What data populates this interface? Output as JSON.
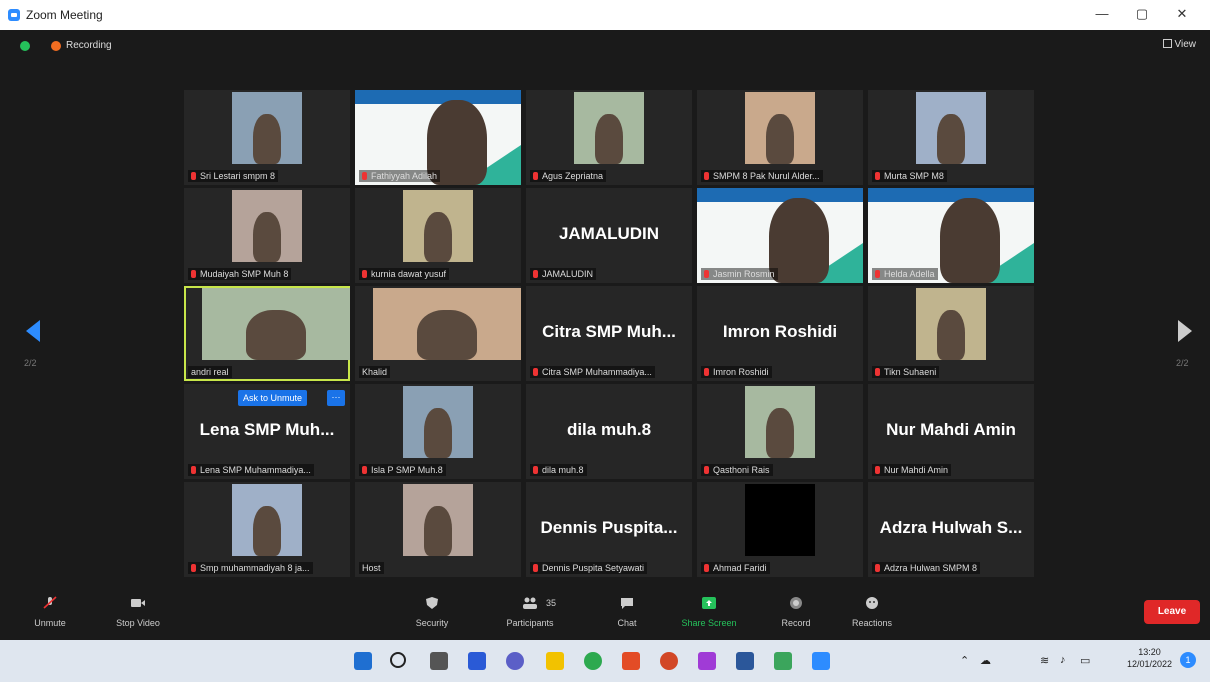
{
  "window": {
    "title": "Zoom Meeting",
    "minimize": "—",
    "restore": "▢",
    "close": "✕"
  },
  "topbar": {
    "recording_label": "Recording",
    "view_label": "View"
  },
  "pager": {
    "left": "2/2",
    "right": "2/2"
  },
  "participants": [
    {
      "name": "Sri Lestari smpm 8",
      "kind": "video"
    },
    {
      "name": "Fathiyyah Adilah",
      "kind": "slide"
    },
    {
      "name": "Agus Zepriatna",
      "kind": "video"
    },
    {
      "name": "SMPM 8 Pak Nurul Alder...",
      "kind": "video"
    },
    {
      "name": "Murta SMP M8",
      "kind": "video"
    },
    {
      "name": "Mudaiyah SMP Muh 8",
      "kind": "video"
    },
    {
      "name": "kurnia dawat yusuf",
      "kind": "video"
    },
    {
      "name": "JAMALUDIN",
      "kind": "text",
      "big": "JAMALUDIN"
    },
    {
      "name": "Jasmin Rosmin",
      "kind": "slide"
    },
    {
      "name": "Helda Adella",
      "kind": "slide"
    },
    {
      "name": "andri real",
      "kind": "video",
      "active": true
    },
    {
      "name": "Khalid",
      "kind": "video"
    },
    {
      "name": "Citra SMP Muhammadiya...",
      "kind": "text",
      "big": "Citra SMP Muh..."
    },
    {
      "name": "Imron Roshidi",
      "kind": "text",
      "big": "Imron Roshidi"
    },
    {
      "name": "Tikn Suhaeni",
      "kind": "video"
    },
    {
      "name": "Lena SMP Muhammadiya...",
      "kind": "text",
      "big": "Lena SMP Muh..."
    },
    {
      "name": "Isla P SMP Muh.8",
      "kind": "video"
    },
    {
      "name": "dila muh.8",
      "kind": "text",
      "big": "dila muh.8"
    },
    {
      "name": "Qasthoni Rais",
      "kind": "video"
    },
    {
      "name": "Nur Mahdi Amin",
      "kind": "text",
      "big": "Nur Mahdi Amin"
    },
    {
      "name": "Smp muhammadiyah 8 ja...",
      "kind": "video"
    },
    {
      "name": "Host",
      "kind": "video"
    },
    {
      "name": "Dennis Puspita Setyawati",
      "kind": "text",
      "big": "Dennis Puspita..."
    },
    {
      "name": "Ahmad Faridi",
      "kind": "video"
    },
    {
      "name": "Adzra Hulwan SMPM 8",
      "kind": "text",
      "big": "Adzra Hulwah S..."
    }
  ],
  "ask_to_unmute": "Ask to Unmute",
  "more": "···",
  "toolbar": {
    "unmute": "Unmute",
    "stop_video": "Stop Video",
    "security": "Security",
    "participants": "Participants",
    "participants_count": "35",
    "chat": "Chat",
    "share_screen": "Share Screen",
    "record": "Record",
    "reactions": "Reactions",
    "leave": "Leave"
  },
  "taskbar": {
    "time": "13:20",
    "date": "12/01/2022"
  },
  "colors": {
    "zoom_blue": "#2d8cff",
    "leave_red": "#e02828",
    "share_green": "#25c15b",
    "active_speaker": "#c8e64a"
  }
}
